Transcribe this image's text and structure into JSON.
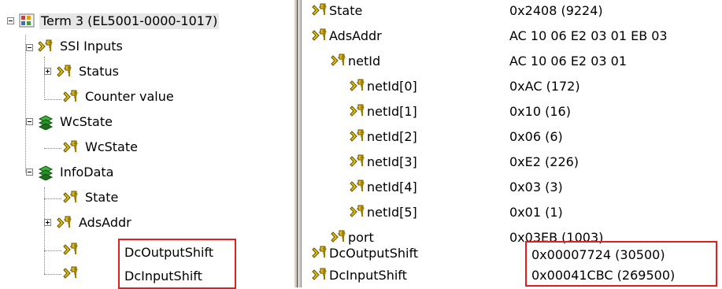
{
  "tree": {
    "root": "Term 3 (EL5001-0000-1017)",
    "ssi_inputs": "SSI Inputs",
    "status": "Status",
    "counter_value": "Counter value",
    "wcstate_group": "WcState",
    "wcstate": "WcState",
    "infodata": "InfoData",
    "state": "State",
    "adsaddr": "AdsAddr",
    "dc_output_shift": "DcOutputShift",
    "dc_input_shift": "DcInputShift"
  },
  "properties": {
    "rows": [
      {
        "name": "State",
        "value": "0x2408 (9224)"
      },
      {
        "name": "AdsAddr",
        "value": "AC 10 06 E2 03 01 EB 03"
      },
      {
        "name": "netId",
        "value": "AC 10 06 E2 03 01"
      },
      {
        "name": "netId[0]",
        "value": "0xAC (172)"
      },
      {
        "name": "netId[1]",
        "value": "0x10 (16)"
      },
      {
        "name": "netId[2]",
        "value": "0x06 (6)"
      },
      {
        "name": "netId[3]",
        "value": "0xE2 (226)"
      },
      {
        "name": "netId[4]",
        "value": "0x03 (3)"
      },
      {
        "name": "netId[5]",
        "value": "0x01 (1)"
      },
      {
        "name": "port",
        "value": "0x03EB (1003)"
      },
      {
        "name": "DcOutputShift",
        "value": "0x00007724 (30500)"
      },
      {
        "name": "DcInputShift",
        "value": "0x00041CBC (269500)"
      }
    ]
  },
  "colors": {
    "highlight": "#e02020",
    "selection": "#e6e6e6"
  }
}
